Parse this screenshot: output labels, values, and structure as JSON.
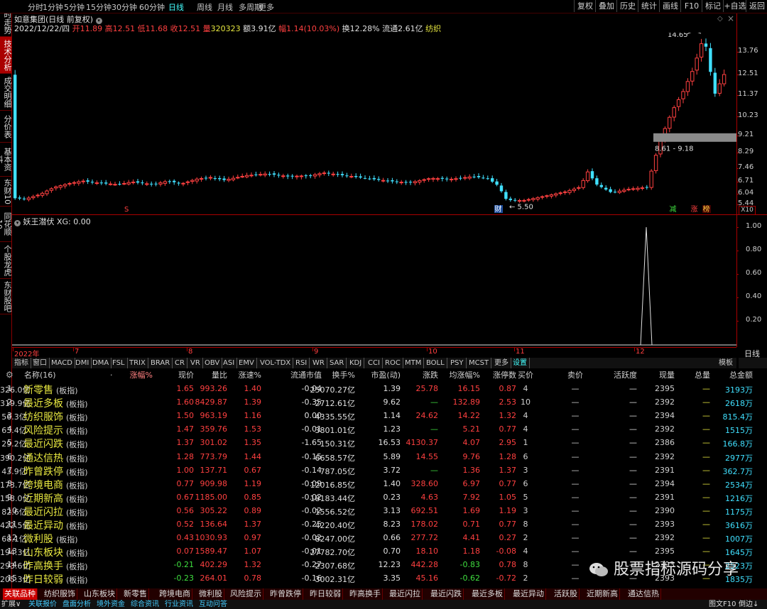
{
  "topbar": {
    "periods": [
      "分时",
      "1分钟",
      "5分钟",
      "15分钟",
      "30分钟",
      "60分钟",
      "日线",
      "周线",
      "月线",
      "多周期",
      "更多"
    ],
    "active": "日线",
    "right_buttons": [
      "复权",
      "叠加",
      "历史",
      "统计",
      "画线",
      "F10",
      "标记",
      "+自选",
      "返回"
    ]
  },
  "sidebar": [
    "分时走势",
    "技术分析",
    "成交明细",
    "分价表",
    "基本资料",
    "东财10",
    "同花顺10",
    "个股龙虎",
    "东财股吧"
  ],
  "sidebar_active": "技术分析",
  "stock": {
    "title": "如意集团(日线 前复权)",
    "date": "2022/12/22/四",
    "open_label": "开",
    "open": "11.89",
    "high_label": "高",
    "high": "12.51",
    "low_label": "低",
    "low": "11.68",
    "close_label": "收",
    "close": "12.51",
    "vol_label": "量",
    "vol": "320323",
    "amt_label": "额",
    "amt": "3.91亿",
    "chg_label": "幅",
    "chg": "1.14(10.03%)",
    "turn_label": "换",
    "turn": "12.28%",
    "float_label": "流通",
    "float": "2.61亿",
    "sector": "纺织"
  },
  "chart": {
    "yticks": [
      "13.76",
      "12.51",
      "11.37",
      "10.23",
      "9.21",
      "8.29",
      "7.46",
      "6.71",
      "6.04",
      "5.44"
    ],
    "high_mark": "14.65",
    "low_mark": "5.50",
    "range_label": "8.61 - 9.18",
    "markers": {
      "s": "S",
      "cai": "财",
      "jian": "减",
      "zhang": "涨",
      "ban": "榜"
    },
    "x10": "X10",
    "months": [
      "2022年",
      "7",
      "8",
      "9",
      "10",
      "11",
      "12"
    ],
    "period_btn": "日线"
  },
  "indicator": {
    "title": "妖王潜伏",
    "value": "XG: 0.00",
    "yticks": [
      "1.00",
      "0.80",
      "0.60",
      "0.40",
      "0.20"
    ]
  },
  "ind_tabs": [
    "指标",
    "窗口",
    "MACD",
    "DMI",
    "DMA",
    "FSL",
    "TRIX",
    "BRAR",
    "CR",
    "VR",
    "OBV",
    "ASI",
    "EMV",
    "VOL-TDX",
    "RSI",
    "WR",
    "SAR",
    "KDJ",
    "CCI",
    "ROC",
    "MTM",
    "BOLL",
    "PSY",
    "MCST",
    "更多",
    "设置"
  ],
  "ind_tab_right": "模板",
  "table": {
    "headers": [
      "名称(16)",
      "·",
      "涨幅%",
      "现价",
      "量比",
      "涨速%",
      "流通市值",
      "换手%",
      "市盈(动)",
      "涨跌",
      "均涨幅%",
      "涨停数",
      "买价",
      "卖价",
      "活跃度",
      "现量",
      "总量",
      "总金额"
    ],
    "tag": "(板指)",
    "rows": [
      [
        "1",
        "新零售",
        "1.65",
        "993.26",
        "1.40",
        "-0.04",
        "25070.27亿",
        "1.39",
        "25.78",
        "16.15",
        "0.87",
        "4",
        "—",
        "—",
        "2395",
        "—",
        "3193万",
        "326.0亿"
      ],
      [
        "2",
        "最近多板",
        "1.60",
        "8429.87",
        "1.39",
        "-0.35",
        "2712.61亿",
        "9.62",
        "—",
        "132.89",
        "2.53",
        "10",
        "—",
        "—",
        "2392",
        "—",
        "2618万",
        "319.9亿"
      ],
      [
        "3",
        "纺织服饰",
        "1.50",
        "963.19",
        "1.16",
        "0.00",
        "4335.55亿",
        "1.14",
        "24.62",
        "14.22",
        "1.32",
        "4",
        "—",
        "—",
        "2394",
        "—",
        "815.4万",
        "56.3亿"
      ],
      [
        "4",
        "风险提示",
        "1.47",
        "359.76",
        "1.53",
        "-0.01",
        "3801.01亿",
        "1.23",
        "—",
        "5.21",
        "0.77",
        "4",
        "—",
        "—",
        "2392",
        "—",
        "1515万",
        "63.4亿"
      ],
      [
        "5",
        "最近闪跌",
        "1.37",
        "301.02",
        "1.35",
        "-1.65",
        "150.31亿",
        "16.53",
        "4130.37",
        "4.07",
        "2.95",
        "1",
        "—",
        "—",
        "2386",
        "—",
        "166.8万",
        "29.2亿"
      ],
      [
        "6",
        "通达信热",
        "1.28",
        "773.79",
        "1.44",
        "-0.15",
        "6658.57亿",
        "5.89",
        "14.55",
        "9.76",
        "1.28",
        "6",
        "—",
        "—",
        "2392",
        "—",
        "2977万",
        "390.2亿"
      ],
      [
        "7",
        "昨曾跌停",
        "1.00",
        "137.71",
        "0.67",
        "-0.14",
        "787.05亿",
        "3.72",
        "—",
        "1.36",
        "1.37",
        "3",
        "—",
        "—",
        "2391",
        "—",
        "362.7万",
        "43.9亿"
      ],
      [
        "8",
        "跨境电商",
        "0.77",
        "909.98",
        "1.19",
        "-0.09",
        "12016.85亿",
        "1.40",
        "328.60",
        "6.97",
        "0.77",
        "6",
        "—",
        "—",
        "2394",
        "—",
        "2534万",
        "173.7亿"
      ],
      [
        "9",
        "近期新高",
        "0.67",
        "1185.00",
        "0.85",
        "-0.02",
        "18183.44亿",
        "0.23",
        "4.63",
        "7.92",
        "1.05",
        "5",
        "—",
        "—",
        "2391",
        "—",
        "1216万",
        "158.0亿"
      ],
      [
        "10",
        "最近闪拉",
        "0.56",
        "305.22",
        "0.89",
        "-0.02",
        "1556.52亿",
        "3.13",
        "692.51",
        "1.69",
        "1.19",
        "3",
        "—",
        "—",
        "2390",
        "—",
        "1175万",
        "82.6亿"
      ],
      [
        "11",
        "最近异动",
        "0.52",
        "136.64",
        "1.37",
        "-0.25",
        "4220.40亿",
        "8.23",
        "178.02",
        "0.71",
        "0.77",
        "8",
        "—",
        "—",
        "2393",
        "—",
        "3616万",
        "422.5亿"
      ],
      [
        "12",
        "微利股",
        "0.43",
        "1030.93",
        "0.97",
        "-0.02",
        "8247.00亿",
        "0.66",
        "277.72",
        "4.41",
        "0.27",
        "2",
        "—",
        "—",
        "2392",
        "—",
        "1007万",
        "68.1亿"
      ],
      [
        "13",
        "山东板块",
        "0.07",
        "1589.47",
        "1.07",
        "-0.01",
        "27782.70亿",
        "0.70",
        "18.10",
        "1.18",
        "-0.08",
        "4",
        "—",
        "—",
        "2395",
        "—",
        "1645万",
        "194.3亿"
      ],
      [
        "14",
        "昨高换手",
        "-0.21",
        "402.29",
        "1.32",
        "-0.27",
        "2307.68亿",
        "12.23",
        "442.28",
        "-0.83",
        "0.78",
        "8",
        "—",
        "—",
        "2393",
        "—",
        "2523万",
        "293.6亿"
      ],
      [
        "15",
        "昨日较弱",
        "-0.23",
        "264.01",
        "0.78",
        "-0.16",
        "3002.31亿",
        "3.35",
        "45.16",
        "-0.62",
        "-0.72",
        "2",
        "—",
        "—",
        "2393",
        "—",
        "1835万",
        "205.3亿"
      ]
    ]
  },
  "bottom_tabs": [
    "关联品种",
    "纺织服饰",
    "山东板块",
    "新零售",
    "跨境电商",
    "微利股",
    "风险提示",
    "昨曾跌停",
    "昨日较弱",
    "昨高换手",
    "最近闪拉",
    "最近闪跌",
    "最近多板",
    "最近异动",
    "活跃股",
    "近期新高",
    "通达信热"
  ],
  "bottom_active": "关联品种",
  "status": [
    "扩展∨",
    "关联报价",
    "盘面分析",
    "境外资金",
    "综合资讯",
    "行业资讯",
    "互动问答"
  ],
  "status_right": [
    "图文F10",
    "倒边↓"
  ],
  "watermark": "股票指标源码分享",
  "colors": {
    "up": "#ff4040",
    "down": "#40e0ff",
    "yellow": "#e8e840",
    "green": "#3fdf3f",
    "axis": "#aa0000"
  }
}
